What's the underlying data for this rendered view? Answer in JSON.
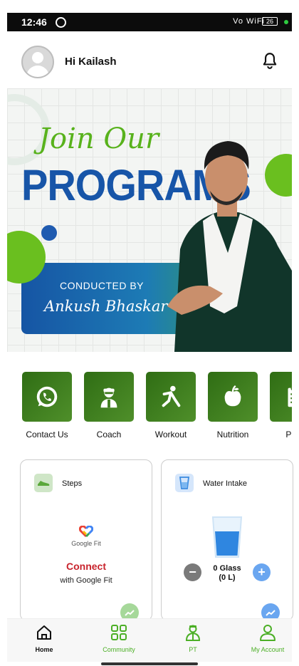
{
  "status_bar": {
    "time": "12:46",
    "signal_text": "Vo WiFi",
    "battery": "26"
  },
  "header": {
    "greeting": "Hi Kailash"
  },
  "banner": {
    "join_text": "Join Our",
    "headline": "PROGRAMS",
    "conducted_by": "CONDUCTED BY",
    "signature": "Ankush Bhaskar"
  },
  "quick_actions": [
    {
      "label": "Contact Us",
      "icon": "whatsapp-icon"
    },
    {
      "label": "Coach",
      "icon": "coach-icon"
    },
    {
      "label": "Workout",
      "icon": "workout-icon"
    },
    {
      "label": "Nutrition",
      "icon": "apple-icon"
    },
    {
      "label": "Prog",
      "icon": "clipboard-icon"
    }
  ],
  "steps_card": {
    "title": "Steps",
    "provider": "Google Fit",
    "connect": "Connect",
    "connect_sub": "with Google Fit"
  },
  "water_card": {
    "title": "Water Intake",
    "glasses": "0 Glass",
    "litres": "(0 L)"
  },
  "bottom_nav": [
    {
      "label": "Home",
      "icon": "home-icon",
      "active": true
    },
    {
      "label": "Community",
      "icon": "community-icon",
      "active": false
    },
    {
      "label": "PT",
      "icon": "pt-icon",
      "active": false
    },
    {
      "label": "My Account",
      "icon": "account-icon",
      "active": false
    }
  ],
  "colors": {
    "brand_green": "#4caf26",
    "brand_blue": "#1755a8",
    "connect_red": "#c8232c"
  }
}
